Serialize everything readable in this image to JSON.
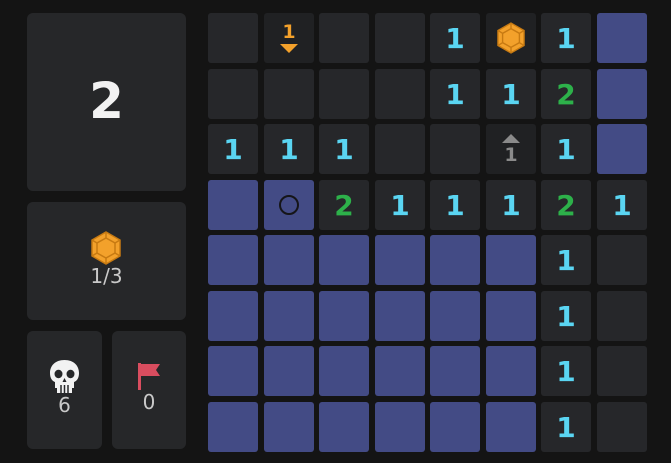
{
  "level": "2",
  "gems": {
    "icon": "gem-icon",
    "count_text": "1/3"
  },
  "deaths": {
    "icon": "skull-icon",
    "count": "6"
  },
  "flags": {
    "icon": "flag-icon",
    "count": "0"
  },
  "colors": {
    "hidden_cell": "#434b85",
    "revealed_cell": "#26272a",
    "number_1": "#5ad5f2",
    "number_2": "#2db14a",
    "gem": "#f3a12b",
    "flag": "#d94d5f",
    "arrow_down": "#f3a12b",
    "arrow_up": "#8a8a8a"
  },
  "board": {
    "rows": [
      [
        {
          "state": "revealed",
          "text": ""
        },
        {
          "state": "arrow-down",
          "text": "1"
        },
        {
          "state": "revealed",
          "text": ""
        },
        {
          "state": "revealed",
          "text": ""
        },
        {
          "state": "revealed",
          "text": "1"
        },
        {
          "state": "gem",
          "text": ""
        },
        {
          "state": "revealed",
          "text": "1"
        },
        {
          "state": "hidden",
          "text": ""
        }
      ],
      [
        {
          "state": "revealed",
          "text": ""
        },
        {
          "state": "revealed",
          "text": ""
        },
        {
          "state": "revealed",
          "text": ""
        },
        {
          "state": "revealed",
          "text": ""
        },
        {
          "state": "revealed",
          "text": "1"
        },
        {
          "state": "revealed",
          "text": "1"
        },
        {
          "state": "revealed",
          "text": "2"
        },
        {
          "state": "hidden",
          "text": ""
        }
      ],
      [
        {
          "state": "revealed",
          "text": "1"
        },
        {
          "state": "revealed",
          "text": "1"
        },
        {
          "state": "revealed",
          "text": "1"
        },
        {
          "state": "revealed",
          "text": ""
        },
        {
          "state": "revealed",
          "text": ""
        },
        {
          "state": "arrow-up",
          "text": "1"
        },
        {
          "state": "revealed",
          "text": "1"
        },
        {
          "state": "hidden",
          "text": ""
        }
      ],
      [
        {
          "state": "hidden",
          "text": ""
        },
        {
          "state": "hidden-cursor",
          "text": ""
        },
        {
          "state": "revealed",
          "text": "2"
        },
        {
          "state": "revealed",
          "text": "1"
        },
        {
          "state": "revealed",
          "text": "1"
        },
        {
          "state": "revealed",
          "text": "1"
        },
        {
          "state": "revealed",
          "text": "2"
        },
        {
          "state": "revealed",
          "text": "1"
        }
      ],
      [
        {
          "state": "hidden",
          "text": ""
        },
        {
          "state": "hidden",
          "text": ""
        },
        {
          "state": "hidden",
          "text": ""
        },
        {
          "state": "hidden",
          "text": ""
        },
        {
          "state": "hidden",
          "text": ""
        },
        {
          "state": "hidden",
          "text": ""
        },
        {
          "state": "revealed",
          "text": "1"
        },
        {
          "state": "revealed",
          "text": ""
        }
      ],
      [
        {
          "state": "hidden",
          "text": ""
        },
        {
          "state": "hidden",
          "text": ""
        },
        {
          "state": "hidden",
          "text": ""
        },
        {
          "state": "hidden",
          "text": ""
        },
        {
          "state": "hidden",
          "text": ""
        },
        {
          "state": "hidden",
          "text": ""
        },
        {
          "state": "revealed",
          "text": "1"
        },
        {
          "state": "revealed",
          "text": ""
        }
      ],
      [
        {
          "state": "hidden",
          "text": ""
        },
        {
          "state": "hidden",
          "text": ""
        },
        {
          "state": "hidden",
          "text": ""
        },
        {
          "state": "hidden",
          "text": ""
        },
        {
          "state": "hidden",
          "text": ""
        },
        {
          "state": "hidden",
          "text": ""
        },
        {
          "state": "revealed",
          "text": "1"
        },
        {
          "state": "revealed",
          "text": ""
        }
      ],
      [
        {
          "state": "hidden",
          "text": ""
        },
        {
          "state": "hidden",
          "text": ""
        },
        {
          "state": "hidden",
          "text": ""
        },
        {
          "state": "hidden",
          "text": ""
        },
        {
          "state": "hidden",
          "text": ""
        },
        {
          "state": "hidden",
          "text": ""
        },
        {
          "state": "revealed",
          "text": "1"
        },
        {
          "state": "revealed",
          "text": ""
        }
      ]
    ]
  }
}
